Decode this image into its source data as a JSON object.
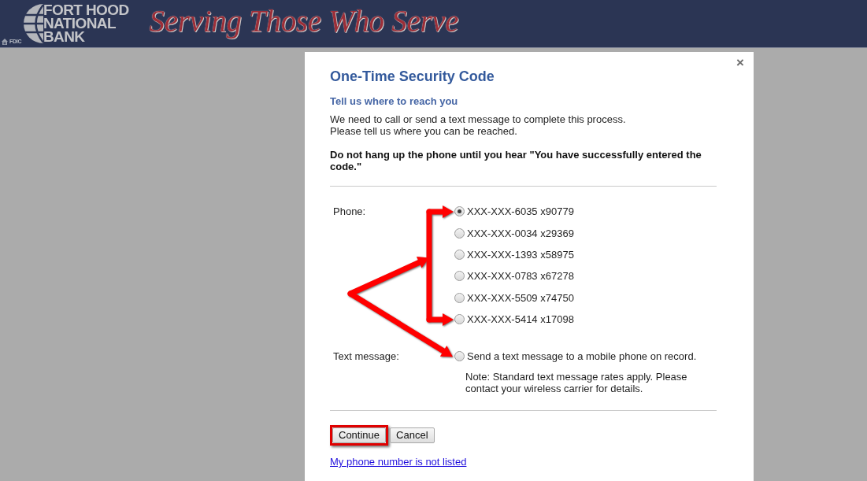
{
  "header": {
    "bank_name": [
      "FORT HOOD",
      "NATIONAL",
      "BANK"
    ],
    "tagline": "Serving Those Who Serve",
    "fdic": "FDIC"
  },
  "dialog": {
    "close": "×",
    "title": "One-Time Security Code",
    "subtitle": "Tell us where to reach you",
    "intro": [
      "We need to call or send a text message to complete this process.",
      "Please tell us where you can be reached."
    ],
    "warning": "Do not hang up the phone until you hear \"You have successfully entered the code.\"",
    "phone": {
      "label": "Phone:",
      "options": [
        {
          "number": "XXX-XXX-6035 x90779",
          "selected": true
        },
        {
          "number": "XXX-XXX-0034 x29369",
          "selected": false
        },
        {
          "number": "XXX-XXX-1393 x58975",
          "selected": false
        },
        {
          "number": "XXX-XXX-0783 x67278",
          "selected": false
        },
        {
          "number": "XXX-XXX-5509 x74750",
          "selected": false
        },
        {
          "number": "XXX-XXX-5414 x17098",
          "selected": false
        }
      ]
    },
    "text_message": {
      "label": "Text message:",
      "option": {
        "text": "Send a text message to a mobile phone on record.",
        "selected": false
      },
      "note": "Note: Standard text message rates apply. Please contact your wireless carrier for details."
    },
    "buttons": [
      {
        "label": "Continue",
        "highlighted": true
      },
      {
        "label": "Cancel",
        "highlighted": false
      }
    ],
    "link": "My phone number is not listed"
  }
}
